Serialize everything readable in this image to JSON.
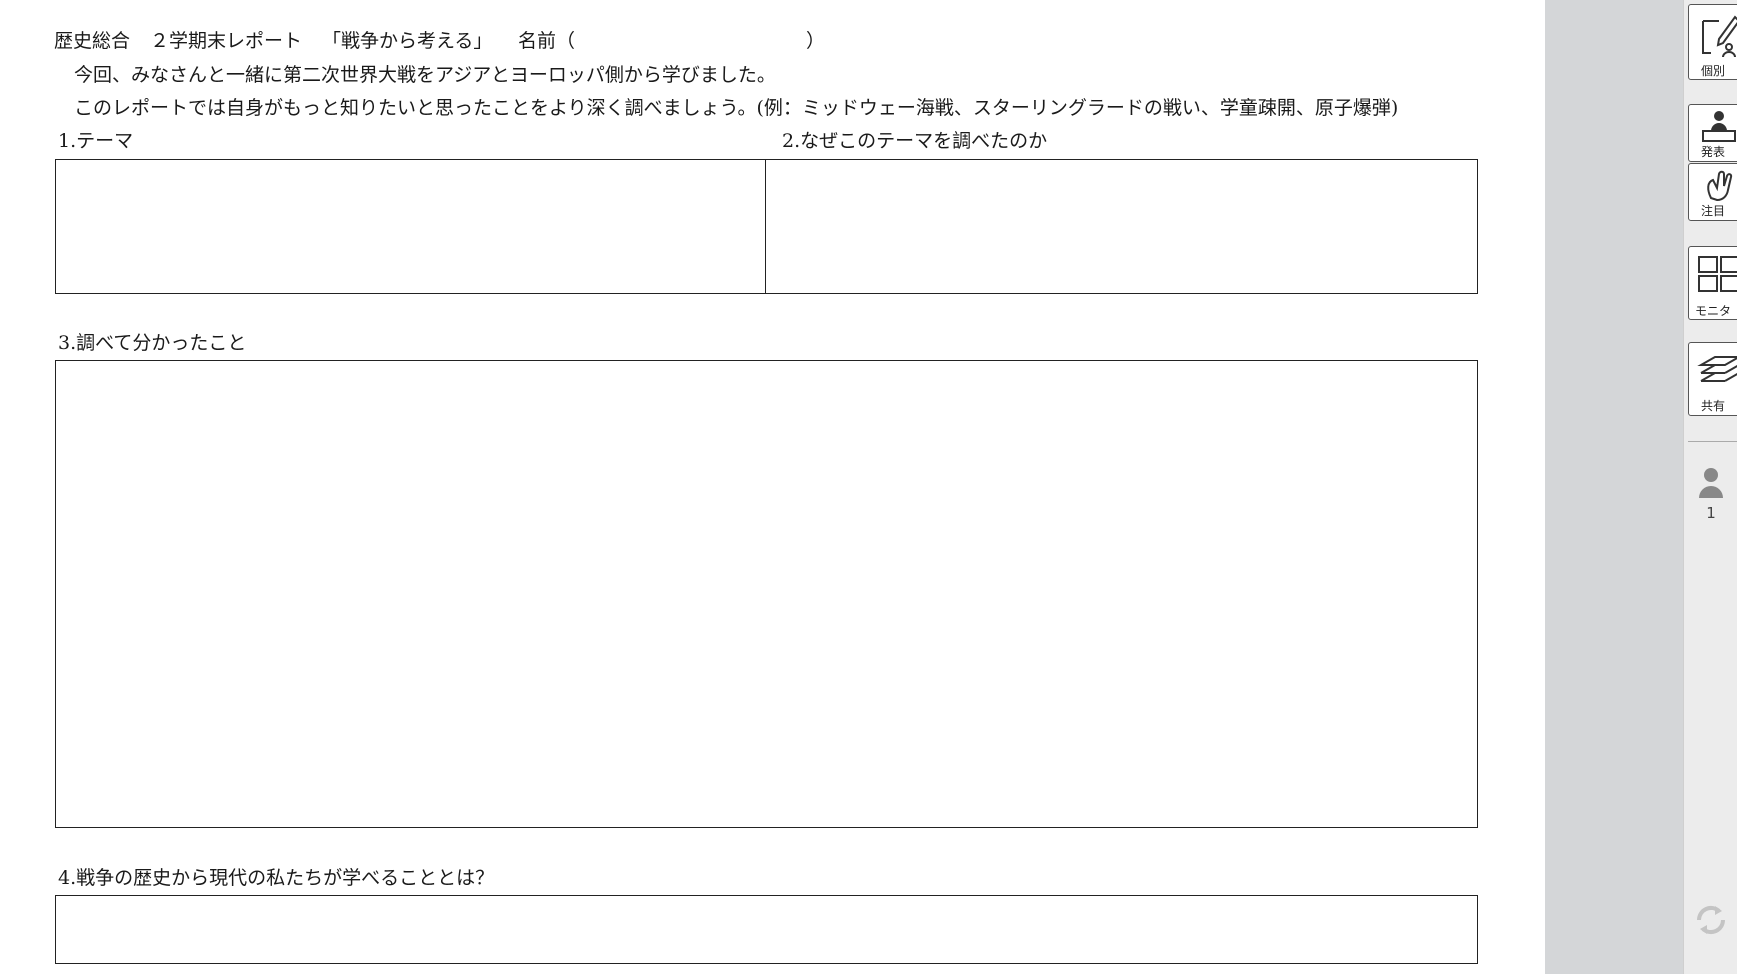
{
  "document": {
    "title": {
      "subject": "歴史総合",
      "term": "２学期末レポート",
      "theme": "「戦争から考える」",
      "name_label": "名前（",
      "name_close": "）"
    },
    "intro1": "今回、みなさんと一緒に第二次世界大戦をアジアとヨーロッパ側から学びました。",
    "intro2": "このレポートでは自身がもっと知りたいと思ったことをより深く調べましょう。(例：ミッドウェー海戦、スターリングラードの戦い、学童疎開、原子爆弾)",
    "sections": {
      "theme_label": "1.テーマ",
      "reason_label": "2.なぜこのテーマを調べたのか",
      "findings_label": "3.調べて分かったこと",
      "lessons_label": "4.戦争の歴史から現代の私たちが学べることとは？"
    }
  },
  "toolbar": {
    "individual_label": "個別",
    "present_label": "発表",
    "attention_label": "注目",
    "monitor_label": "モニタ",
    "share_label": "共有",
    "user_count": "1",
    "icons": [
      "edit-person-icon",
      "presenter-icon",
      "raise-hand-icon",
      "grid-monitor-icon",
      "layers-share-icon",
      "person-icon",
      "refresh-icon"
    ]
  }
}
